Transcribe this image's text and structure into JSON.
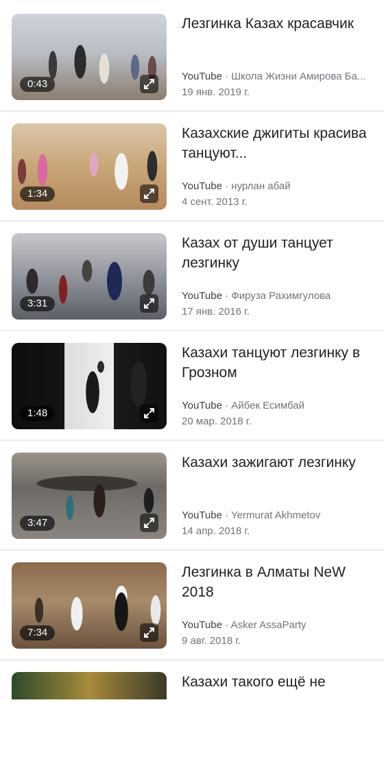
{
  "results": [
    {
      "title": "Лезгинка Казах красавчик",
      "source": "YouTube",
      "separator": " · ",
      "channel": "Школа Жизни Амирова Ба...",
      "date": "19 янв. 2019 г.",
      "duration": "0:43"
    },
    {
      "title": "Казахские джигиты красива танцуют...",
      "source": "YouTube",
      "separator": " · ",
      "channel": "нурлан абай",
      "date": "4 сент. 2013 г.",
      "duration": "1:34"
    },
    {
      "title": "Казах от души танцует лезгинку",
      "source": "YouTube",
      "separator": " · ",
      "channel": "Фируза Рахимгулова",
      "date": "17 янв. 2016 г.",
      "duration": "3:31"
    },
    {
      "title": "Казахи танцуют лезгинку в Грозном",
      "source": "YouTube",
      "separator": " · ",
      "channel": "Айбек Есимбай",
      "date": "20 мар. 2018 г.",
      "duration": "1:48"
    },
    {
      "title": "Казахи зажигают лезгинку",
      "source": "YouTube",
      "separator": " · ",
      "channel": "Yermurat Akhmetov",
      "date": "14 апр. 2018 г.",
      "duration": "3:47"
    },
    {
      "title": "Лезгинка в Алматы NeW 2018",
      "source": "YouTube",
      "separator": " · ",
      "channel": "Asker AssaParty",
      "date": "9 авг. 2018 г.",
      "duration": "7:34"
    }
  ],
  "partial_result": {
    "title": "Казахи такого ещё не"
  },
  "icons": {
    "expand": "expand-arrows-icon"
  },
  "colors": {
    "divider": "#ebebeb",
    "meta": "#70757a",
    "title": "#202124"
  }
}
